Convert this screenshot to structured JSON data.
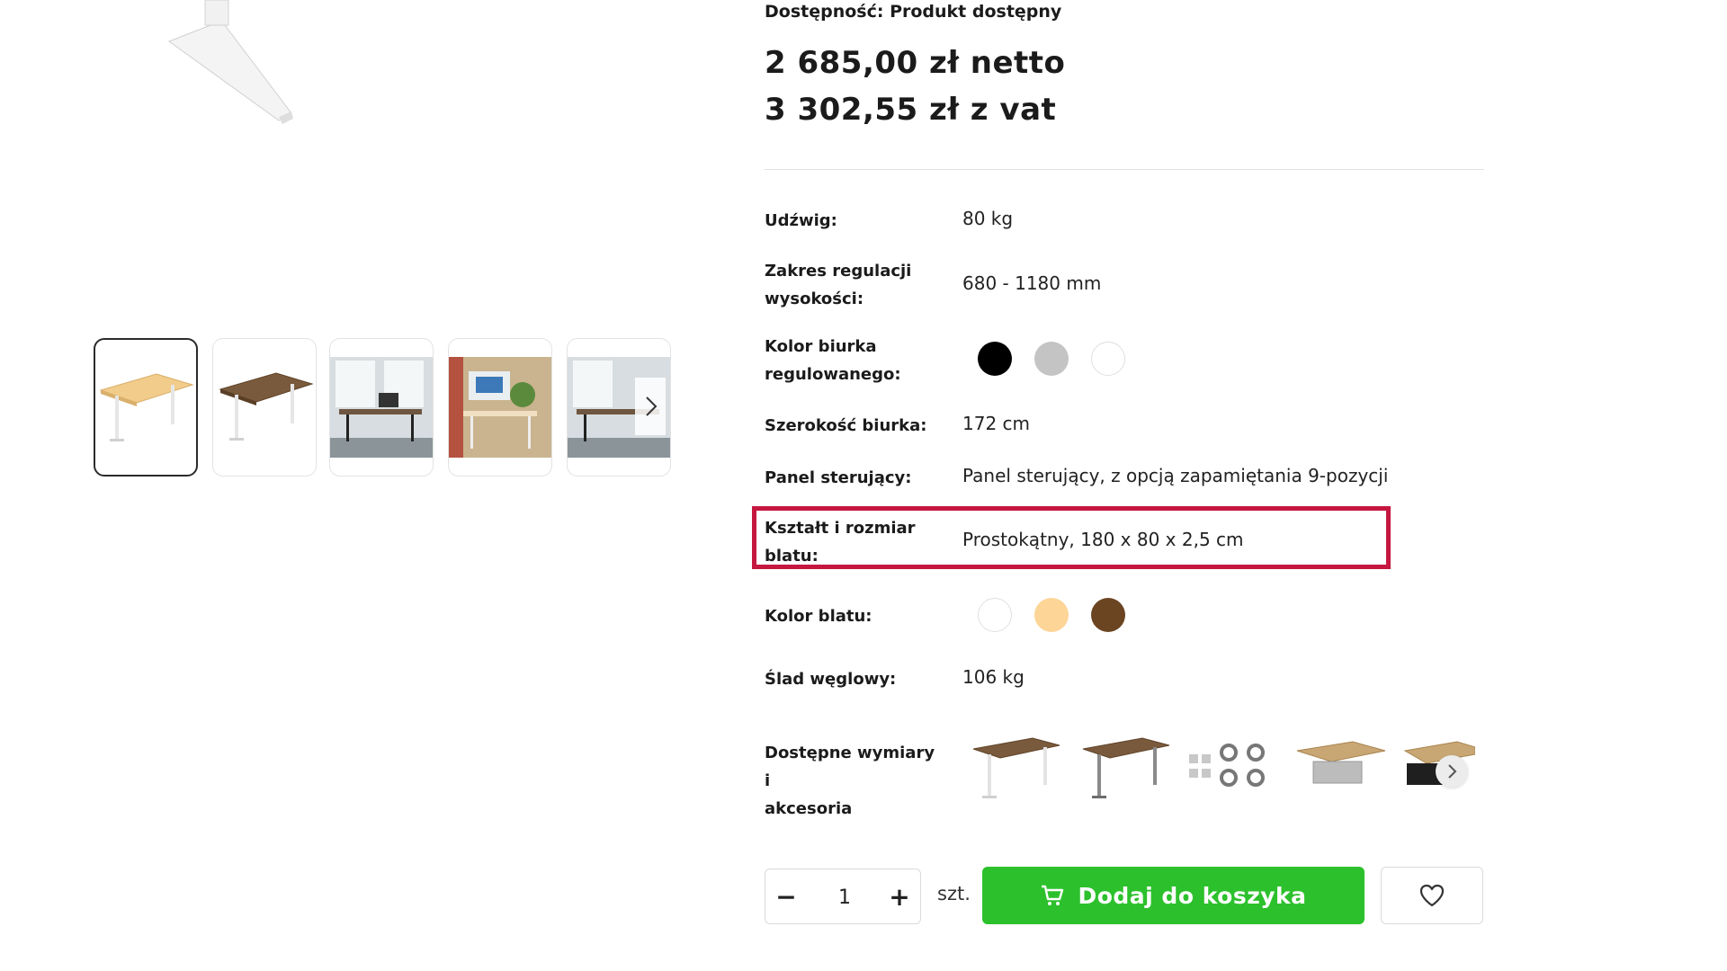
{
  "product": {
    "availability": "Dostępność: Produkt dostępny",
    "price_net": "2 685,00 zł netto",
    "price_gross": "3 302,55 zł z vat"
  },
  "specs": {
    "load": {
      "label": "Udźwig:",
      "value": "80 kg"
    },
    "height_range": {
      "label_line1": "Zakres regulacji",
      "label_line2": "wysokości:",
      "value": "680 - 1180 mm"
    },
    "frame_color": {
      "label_line1": "Kolor biurka",
      "label_line2": "regulowanego:",
      "swatches": [
        "#000000",
        "#c4c4c4",
        "#ffffff"
      ]
    },
    "desk_width": {
      "label": "Szerokość biurka:",
      "value": "172 cm"
    },
    "control_panel": {
      "label": "Panel sterujący:",
      "value": "Panel sterujący, z opcją zapamiętania 9-pozycji"
    },
    "top_shape": {
      "label_line1": "Kształt i rozmiar",
      "label_line2": "blatu:",
      "value": "Prostokątny, 180 x 80 x 2,5 cm"
    },
    "top_color": {
      "label": "Kolor blatu:",
      "swatches": [
        "#ffffff",
        "#fcd597",
        "#6b4421"
      ]
    },
    "carbon": {
      "label": "Ślad węglowy:",
      "value": "106 kg"
    },
    "accessories": {
      "label_line1": "Dostępne wymiary i",
      "label_line2": "akcesoria"
    }
  },
  "gallery": {
    "thumbnails": [
      "thumb-beige-desk",
      "thumb-walnut-desk",
      "thumb-office-black",
      "thumb-office-room",
      "thumb-office-partial"
    ]
  },
  "purchase": {
    "quantity": "1",
    "unit": "szt.",
    "minus": "−",
    "plus": "+",
    "add_to_cart": "Dodaj do koszyka"
  },
  "icons": {
    "cart": "cart-icon",
    "heart": "heart-icon",
    "chevron": "chevron-right-icon"
  },
  "colors": {
    "accent_green": "#2cc12c",
    "highlight_red": "#c5173f"
  }
}
